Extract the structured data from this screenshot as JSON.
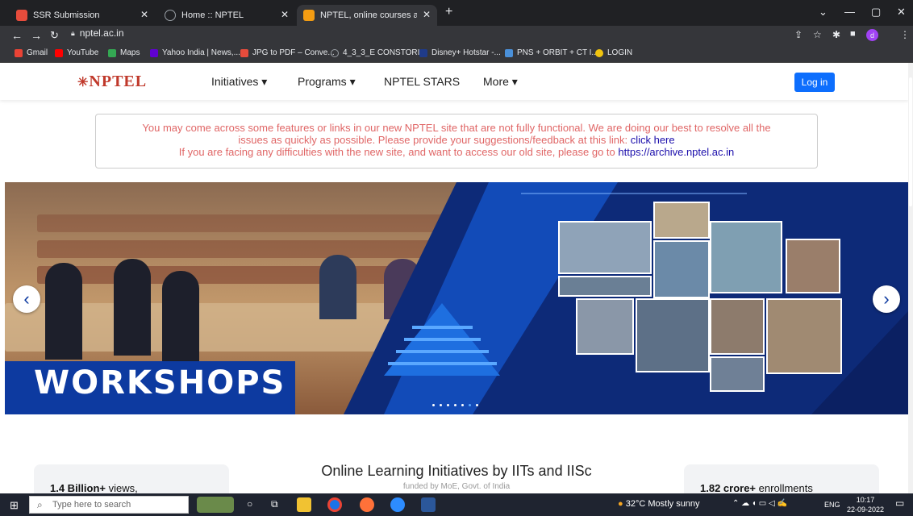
{
  "tabs": [
    {
      "label": "SSR Submission",
      "color": "#e74c3c"
    },
    {
      "label": "Home :: NPTEL",
      "color": "#9aa0a6"
    },
    {
      "label": "NPTEL, online courses and certifi",
      "color": "#f39c12"
    }
  ],
  "address": {
    "url": "nptel.ac.in"
  },
  "bookmarks": [
    "Gmail",
    "YouTube",
    "Maps",
    "Yahoo India | News,...",
    "JPG to PDF – Conve...",
    "4_3_3_E CONSTORI...",
    "Disney+ Hotstar -...",
    "PNS + ORBIT + CT I...",
    "LOGIN"
  ],
  "site": {
    "logo": "NPTEL",
    "menu": [
      "Initiatives ▾",
      "Programs ▾",
      "NPTEL STARS",
      "More ▾"
    ],
    "login": "Log in",
    "notice": {
      "line1": "You may come across some features or links in our new NPTEL site that are not fully functional. We are doing our best to resolve all the",
      "line2": "issues as quickly as possible. Please provide your suggestions/feedback at this link:",
      "link1": "click here",
      "line3": "If you are facing any difficulties with the new site, and want to access our old site, please go to",
      "link2": "https://archive.nptel.ac.in"
    },
    "banner_title": "WORKSHOPS",
    "stats_left": {
      "value": "1.4 Billion+",
      "label": "views,"
    },
    "stats_right": {
      "value": "1.82 crore+",
      "label": "enrollments"
    },
    "center_heading": "Online Learning Initiatives by IITs and IISc",
    "center_sub": "funded by MoE, Govt. of India"
  },
  "taskbar": {
    "search_placeholder": "Type here to search",
    "weather": "32°C  Mostly sunny",
    "lang": "ENG",
    "time": "10:17",
    "date": "22-09-2022"
  }
}
